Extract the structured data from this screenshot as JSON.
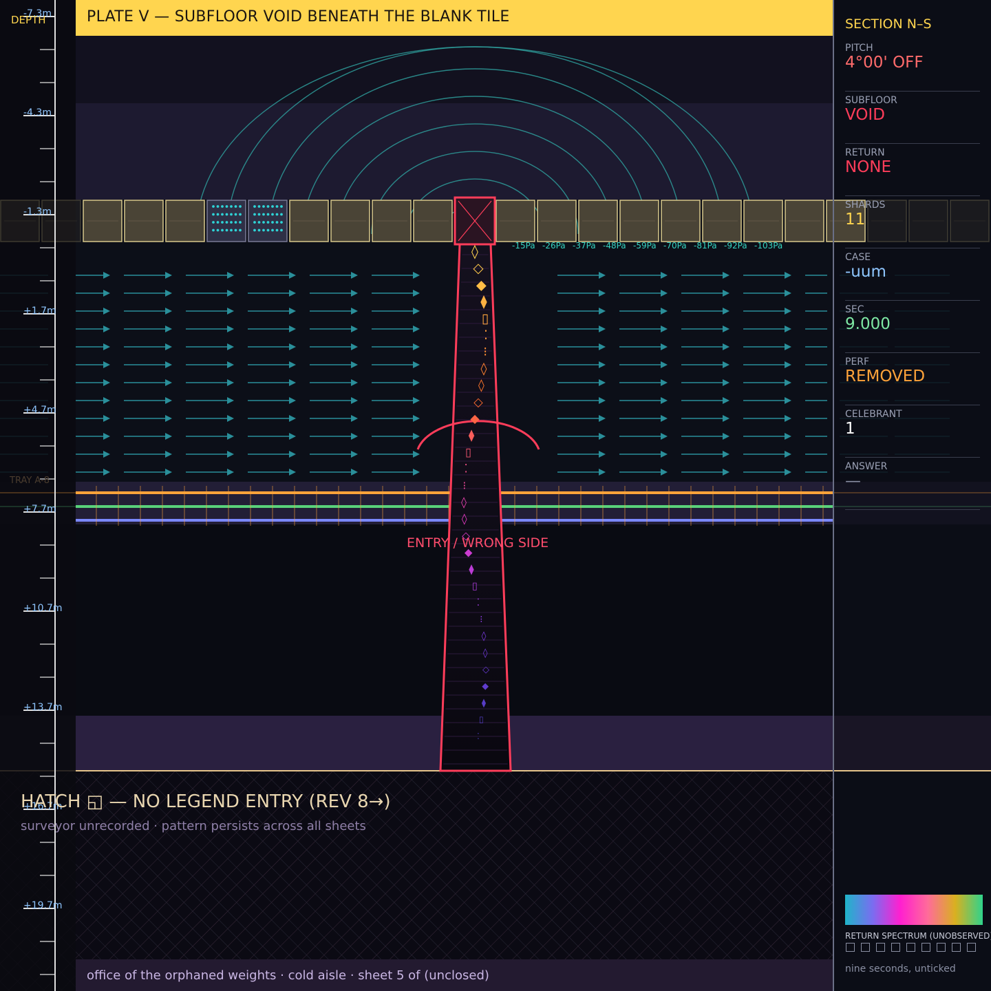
{
  "plate": {
    "title": "PLATE V — SUBFLOOR VOID BENEATH THE BLANK TILE"
  },
  "depth_scale": {
    "header": "DEPTH",
    "labels": [
      "-7.3m",
      "-4.3m",
      "-1.3m",
      "+1.7m",
      "+4.7m",
      "+7.7m",
      "+10.7m",
      "+13.7m",
      "+16.7m",
      "+19.7m"
    ]
  },
  "pressure_labels": [
    "-15Pa",
    "-26Pa",
    "-37Pa",
    "-48Pa",
    "-59Pa",
    "-70Pa",
    "-81Pa",
    "-92Pa",
    "-103Pa"
  ],
  "tray_label": "TRAY A-8",
  "annotations": {
    "entry": "ENTRY / WRONG SIDE"
  },
  "hatch": {
    "title": "HATCH ◱ — NO LEGEND ENTRY (REV 8→)",
    "subtitle": "surveyor unrecorded · pattern persists across all sheets"
  },
  "footer": {
    "text": "office of the orphaned weights · cold aisle · sheet 5 of (unclosed)"
  },
  "section": {
    "title": "SECTION N–S",
    "stats": [
      {
        "key": "PITCH",
        "value": "4°00' OFF",
        "color": "#ff6b6b"
      },
      {
        "key": "SUBFLOOR",
        "value": "VOID",
        "color": "#ff3d5a"
      },
      {
        "key": "RETURN",
        "value": "NONE",
        "color": "#ff3d5a"
      },
      {
        "key": "SHARDS",
        "value": "11",
        "color": "#ffd54f"
      },
      {
        "key": "CASE",
        "value": "-uum",
        "color": "#8fc6ff"
      },
      {
        "key": "SEC",
        "value": "9.000",
        "color": "#7ee8a4"
      },
      {
        "key": "PERF",
        "value": "REMOVED",
        "color": "#ffa33a"
      },
      {
        "key": "CELEBRANT",
        "value": "1",
        "color": "#ffffff"
      },
      {
        "key": "ANSWER",
        "value": "—",
        "color": "#8a8fa3"
      }
    ]
  },
  "spectrum": {
    "label": "RETURN SPECTRUM (UNOBSERVED)",
    "note": "nine seconds, unticked",
    "ticks": 9
  },
  "colors": {
    "accent": "#ffd54f",
    "void": "#ff3d5a",
    "airflow": "#2a8f9a",
    "wave": "#2e9c9a"
  }
}
